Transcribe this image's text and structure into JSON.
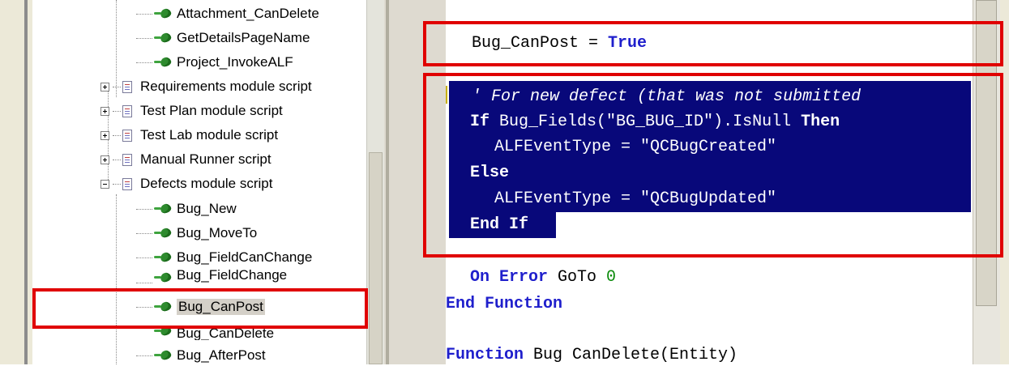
{
  "tree": {
    "items": [
      {
        "label": "Attachment_CanDelete",
        "type": "function"
      },
      {
        "label": "GetDetailsPageName",
        "type": "function"
      },
      {
        "label": "Project_InvokeALF",
        "type": "function"
      },
      {
        "label": "Requirements module script",
        "type": "module",
        "expanded": false
      },
      {
        "label": "Test Plan module script",
        "type": "module",
        "expanded": false
      },
      {
        "label": "Test Lab module script",
        "type": "module",
        "expanded": false
      },
      {
        "label": "Manual Runner script",
        "type": "module",
        "expanded": false
      },
      {
        "label": "Defects module script",
        "type": "module",
        "expanded": true
      },
      {
        "label": "Bug_New",
        "type": "function"
      },
      {
        "label": "Bug_MoveTo",
        "type": "function"
      },
      {
        "label": "Bug_FieldCanChange",
        "type": "function"
      },
      {
        "label": "Bug_FieldChange",
        "type": "function"
      },
      {
        "label": "Bug_CanPost",
        "type": "function",
        "selected": true
      },
      {
        "label": "Bug_CanDelete",
        "type": "function"
      },
      {
        "label": "Bug_AfterPost",
        "type": "function"
      }
    ]
  },
  "editor": {
    "line1": {
      "ident": "Bug_CanPost",
      "op": " = ",
      "kw": "True"
    },
    "comment": "' For new defect (that was not submitted",
    "if_line": {
      "kw_if": "If",
      "expr": " Bug_Fields(\"BG_BUG_ID\").IsNull ",
      "kw_then": "Then"
    },
    "created_line": "ALFEventType = \"QCBugCreated\"",
    "else_kw": "Else",
    "updated_line": "ALFEventType = \"QCBugUpdated\"",
    "endif_kw": "End If",
    "onerror": {
      "kw1": "On Error",
      "mid": " GoTo ",
      "num": "0"
    },
    "endfunc_kw": "End Function",
    "nextfunc": {
      "kw": "Function",
      "rest": " Bug CanDelete(Entity)"
    }
  },
  "colors": {
    "annotation": "#e00000",
    "selection": "#08087a",
    "keyword": "#1f1fcc"
  },
  "icons": {
    "function": "leaf-icon",
    "module": "document-icon",
    "expand": "plus-box-icon",
    "collapse": "minus-box-icon"
  }
}
